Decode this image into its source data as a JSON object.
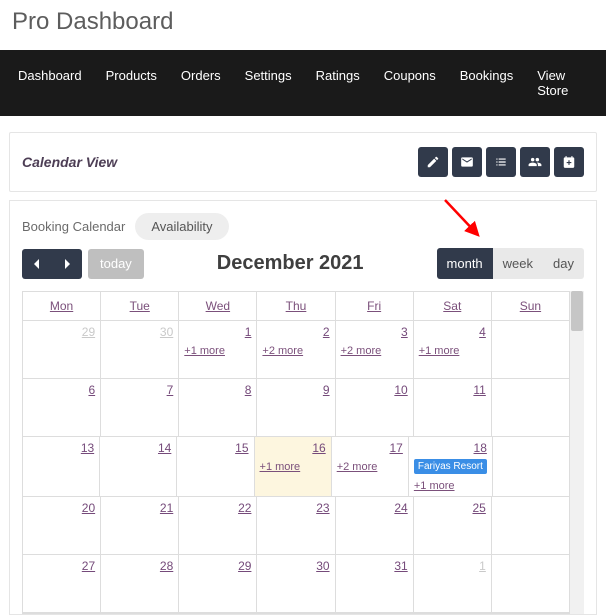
{
  "page_title": "Pro Dashboard",
  "nav": [
    "Dashboard",
    "Products",
    "Orders",
    "Settings",
    "Ratings",
    "Coupons",
    "Bookings",
    "View Store"
  ],
  "panel": {
    "title": "Calendar View"
  },
  "tabs": {
    "label": "Booking Calendar",
    "pill": "Availability"
  },
  "controls": {
    "today": "today",
    "month_title": "December 2021",
    "views": {
      "month": "month",
      "week": "week",
      "day": "day"
    }
  },
  "headers": [
    "Mon",
    "Tue",
    "Wed",
    "Thu",
    "Fri",
    "Sat",
    "Sun"
  ],
  "weeks": [
    [
      {
        "n": "29",
        "muted": true
      },
      {
        "n": "30",
        "muted": true
      },
      {
        "n": "1",
        "more": "+1 more"
      },
      {
        "n": "2",
        "more": "+2 more"
      },
      {
        "n": "3",
        "more": "+2 more"
      },
      {
        "n": "4",
        "more": "+1 more"
      },
      {
        "n": ""
      }
    ],
    [
      {
        "n": "6"
      },
      {
        "n": "7"
      },
      {
        "n": "8"
      },
      {
        "n": "9"
      },
      {
        "n": "10"
      },
      {
        "n": "11"
      },
      {
        "n": ""
      }
    ],
    [
      {
        "n": "13"
      },
      {
        "n": "14"
      },
      {
        "n": "15"
      },
      {
        "n": "16",
        "more": "+1 more",
        "today": true
      },
      {
        "n": "17",
        "more": "+2 more"
      },
      {
        "n": "18",
        "event": "Fariyas Resort",
        "more": "+1 more"
      },
      {
        "n": ""
      }
    ],
    [
      {
        "n": "20"
      },
      {
        "n": "21"
      },
      {
        "n": "22"
      },
      {
        "n": "23"
      },
      {
        "n": "24"
      },
      {
        "n": "25"
      },
      {
        "n": ""
      }
    ],
    [
      {
        "n": "27"
      },
      {
        "n": "28"
      },
      {
        "n": "29"
      },
      {
        "n": "30"
      },
      {
        "n": "31"
      },
      {
        "n": "1",
        "muted": true
      },
      {
        "n": ""
      }
    ]
  ]
}
